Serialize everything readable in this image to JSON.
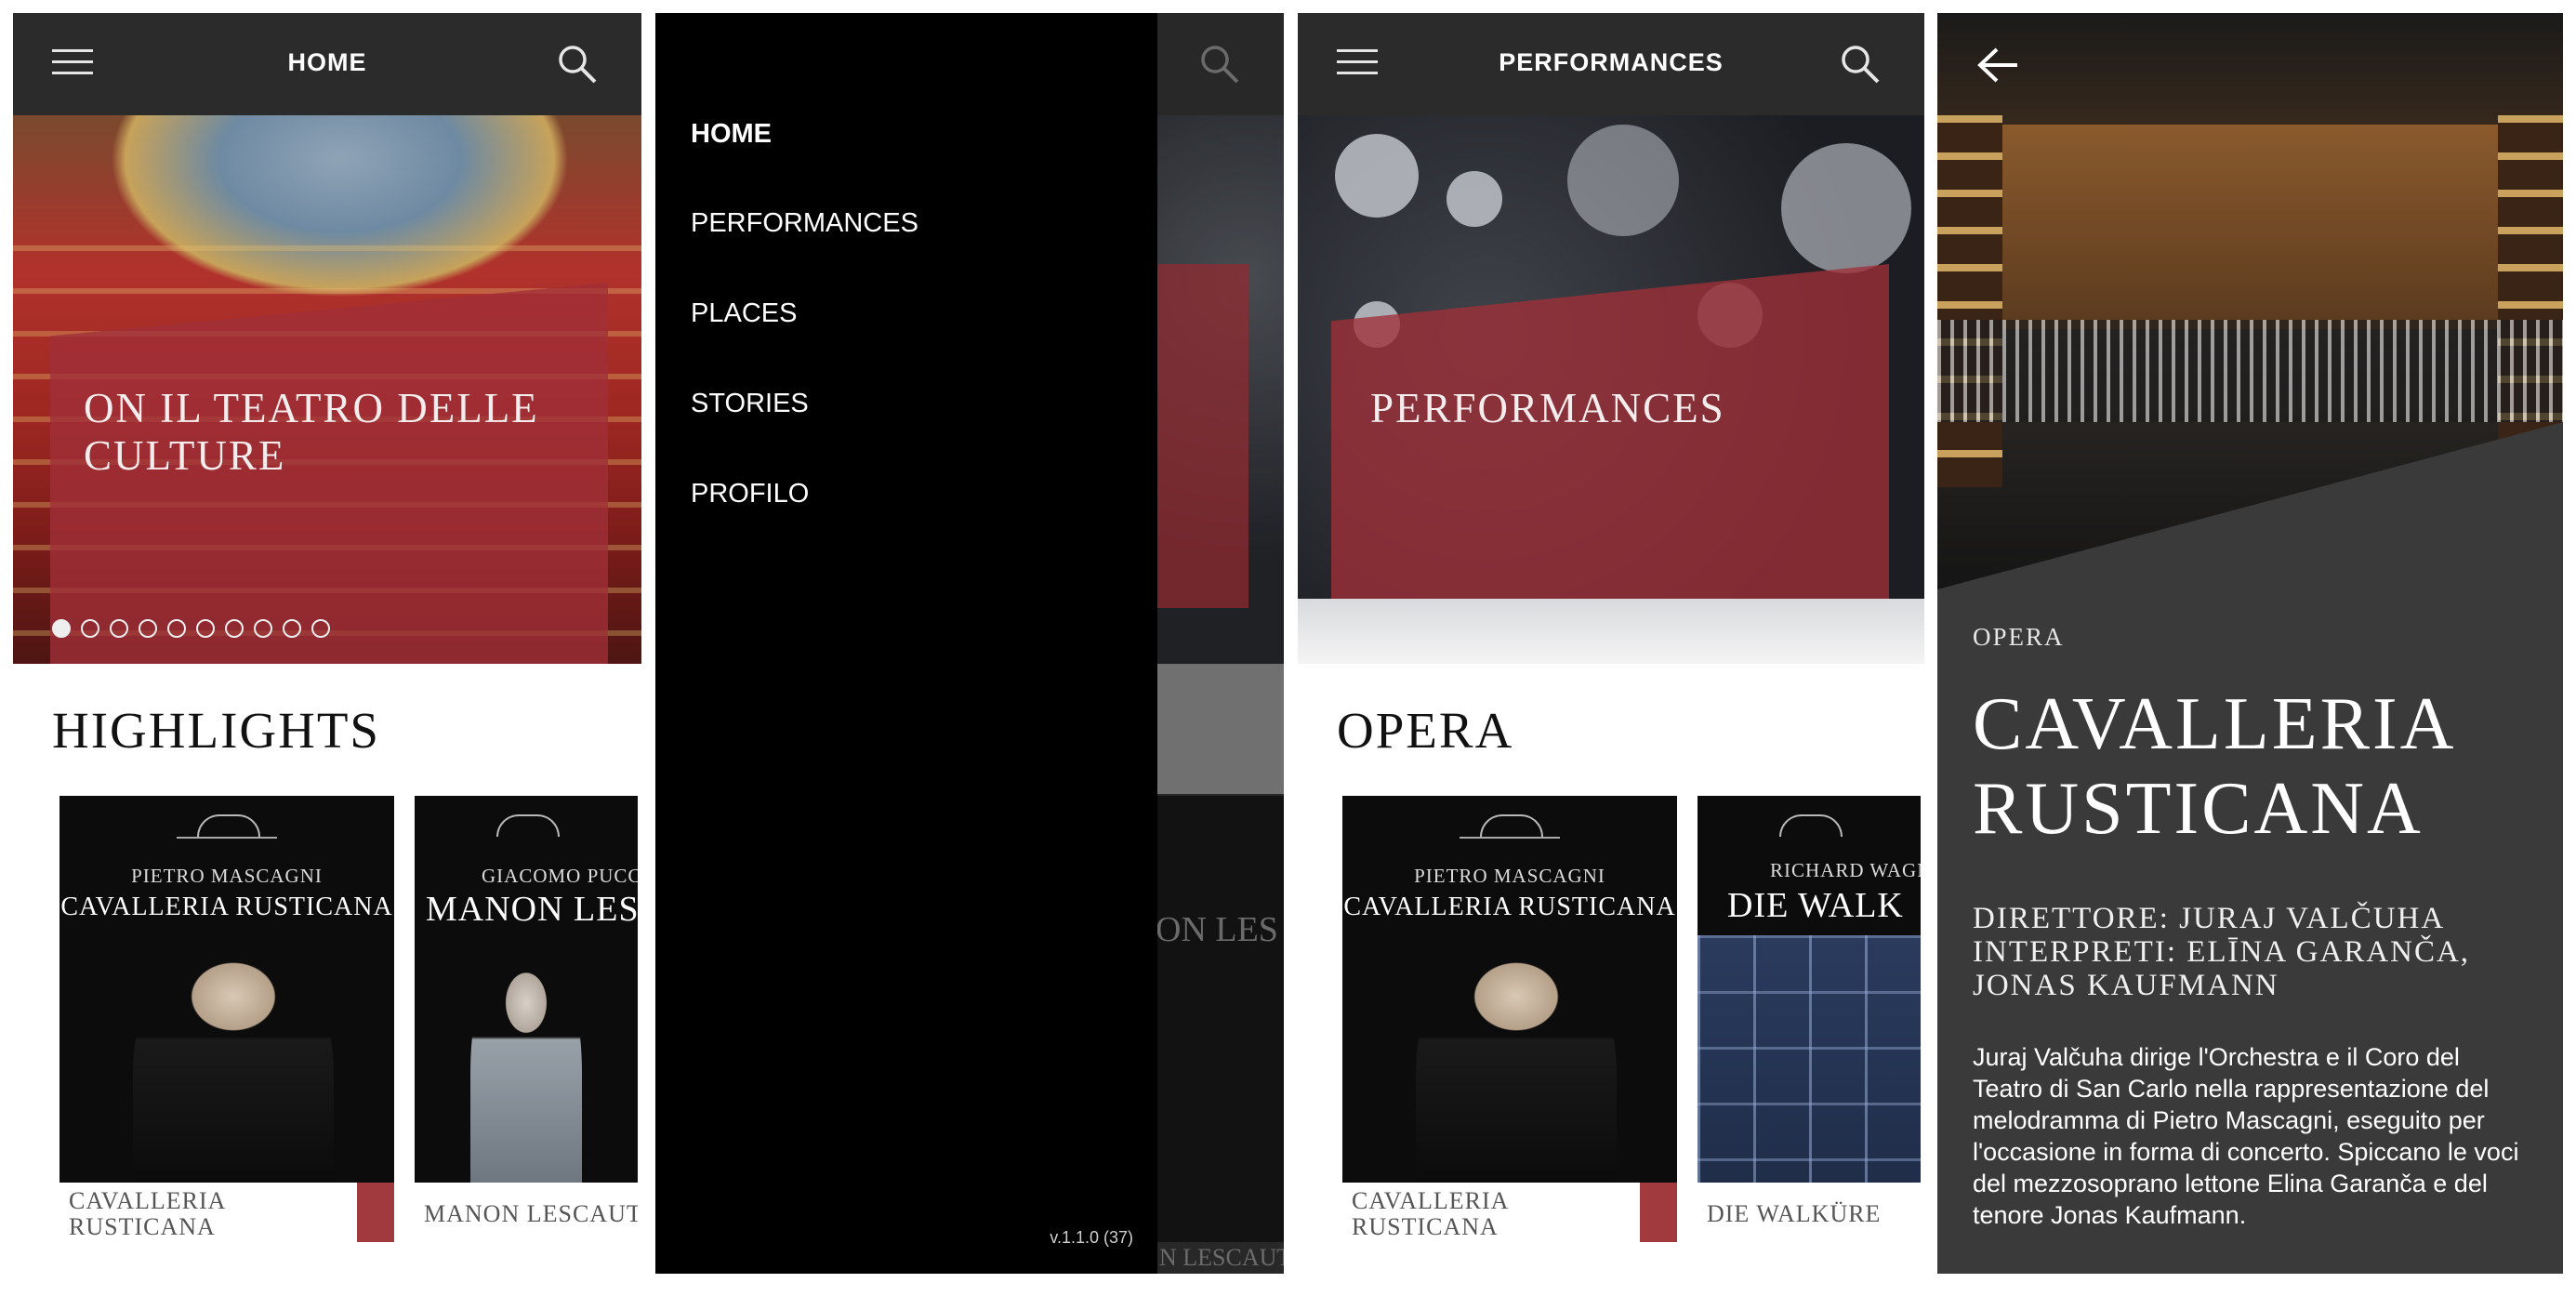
{
  "screen_home": {
    "title": "HOME",
    "hero_text": "ON  IL TEATRO DELLE CULTURE",
    "carousel_count": 10,
    "carousel_active": 1,
    "section_title": "HIGHLIGHTS",
    "cards": [
      {
        "composer": "PIETRO MASCAGNI",
        "poster_title": "CAVALLERIA RUSTICANA",
        "label": "CAVALLERIA RUSTICANA"
      },
      {
        "composer": "GIACOMO PUCC",
        "poster_title": "MANON LES",
        "label": "MANON LESCAUT"
      }
    ]
  },
  "screen_menu": {
    "items": [
      "HOME",
      "PERFORMANCES",
      "PLACES",
      "STORIES",
      "PROFILO"
    ],
    "active": "HOME",
    "version": "v.1.1.0 (37)",
    "peek_title": "ON LES",
    "peek_label": "N LESCAUT"
  },
  "screen_performances": {
    "title": "PERFORMANCES",
    "hero_text": "PERFORMANCES",
    "section_title": "OPERA",
    "cards": [
      {
        "composer": "PIETRO MASCAGNI",
        "poster_title": "CAVALLERIA RUSTICANA",
        "label": "CAVALLERIA RUSTICANA"
      },
      {
        "composer": "RICHARD WAGN",
        "poster_title": "DIE WALK",
        "label": "DIE WALKÜRE"
      }
    ]
  },
  "screen_detail": {
    "category": "OPERA",
    "title": "CAVALLERIA RUSTICANA",
    "credits": "DIRETTORE: JURAJ VALČUHA INTERPRETI: ELĪNA GARANČA, JONAS KAUFMANN",
    "description": "Juraj Valčuha dirige l'Orchestra e il Coro del Teatro di San Carlo nella rappresentazione del melodramma di Pietro Mascagni, eseguito per l'occasione in forma di concerto. Spiccano le voci del mezzosoprano lettone Elina Garanča e del tenore Jonas Kaufmann."
  },
  "theme": {
    "appbar": "#2b2b2b",
    "accent": "#a13a3e",
    "panel": "#3a3a3a"
  },
  "icons": [
    "hamburger-icon",
    "search-icon",
    "back-arrow-icon"
  ]
}
